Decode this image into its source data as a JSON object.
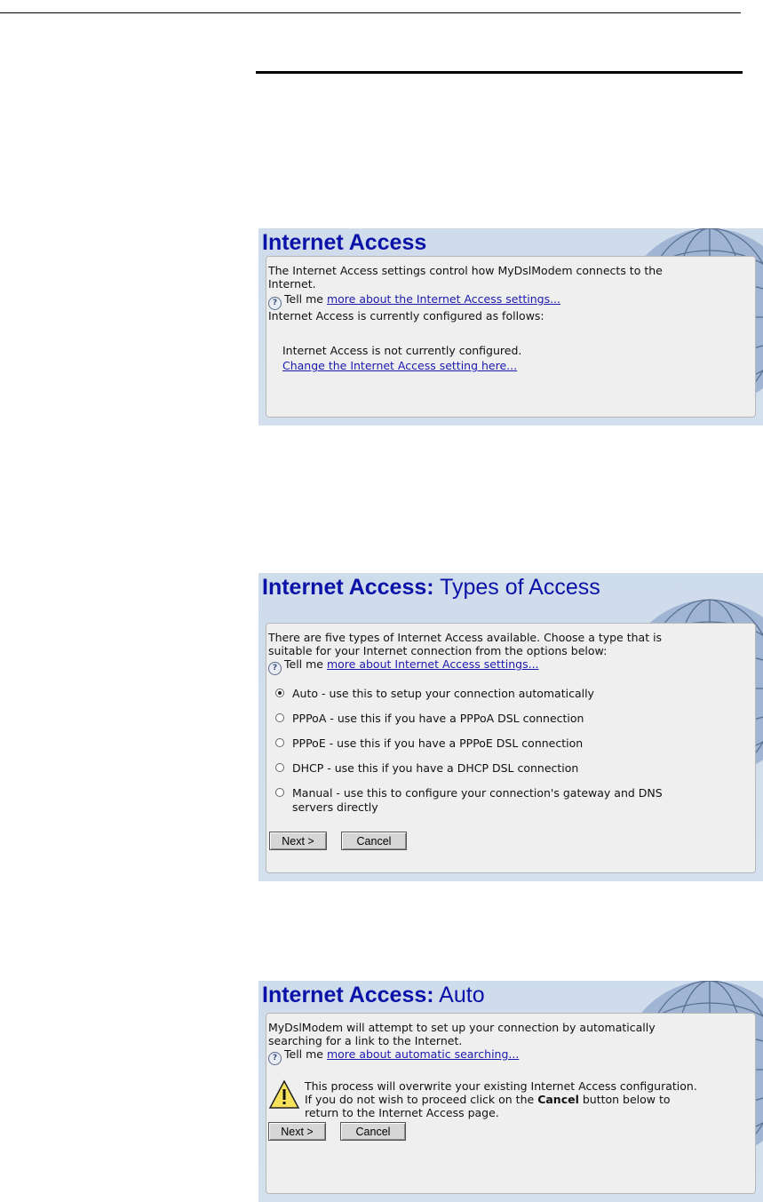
{
  "screen1": {
    "title": "Internet Access",
    "intro_line1": "The Internet Access settings control how MyDslModem connects to the",
    "intro_line2": "Internet.",
    "tell_me": "Tell me",
    "help_link": "more about the Internet Access settings...",
    "config_line": "Internet Access is currently configured as follows:",
    "status": "Internet Access is not currently configured.",
    "change_link": "Change the Internet Access setting here..."
  },
  "screen2": {
    "title_bold": "Internet Access:",
    "title_sub": "Types of Access",
    "intro_line1": "There are five types of Internet Access available. Choose a type that is",
    "intro_line2": "suitable for your Internet connection from the options below:",
    "tell_me": "Tell me",
    "help_link": "more about Internet Access settings...",
    "options": [
      {
        "label": "Auto - use this to setup your connection automatically",
        "selected": true
      },
      {
        "label": "PPPoA - use this if you have a PPPoA DSL connection",
        "selected": false
      },
      {
        "label": "PPPoE - use this if you have a PPPoE DSL connection",
        "selected": false
      },
      {
        "label": "DHCP - use this if you have a DHCP DSL connection",
        "selected": false
      },
      {
        "label": "Manual - use this to configure your connection's gateway and DNS",
        "label2": "servers directly",
        "selected": false
      }
    ],
    "next_label": "Next >",
    "cancel_label": "Cancel"
  },
  "screen3": {
    "title_bold": "Internet Access:",
    "title_sub": "Auto",
    "intro_line1": "MyDslModem will attempt to set up your connection by automatically",
    "intro_line2": "searching for a link to the Internet.",
    "tell_me": "Tell me",
    "help_link": "more about automatic searching...",
    "warn_line1": "This process will overwrite your existing Internet Access configuration.",
    "warn_line2a": "If you do not wish to proceed click on the",
    "warn_bold": "Cancel",
    "warn_line2b": "button below to",
    "warn_line3": "return to the Internet Access page.",
    "next_label": "Next >",
    "cancel_label": "Cancel"
  },
  "colors": {
    "title": "#0b12a8",
    "link": "#1a1ab0",
    "panel": "#efefef",
    "banner": "#cfdcec"
  }
}
